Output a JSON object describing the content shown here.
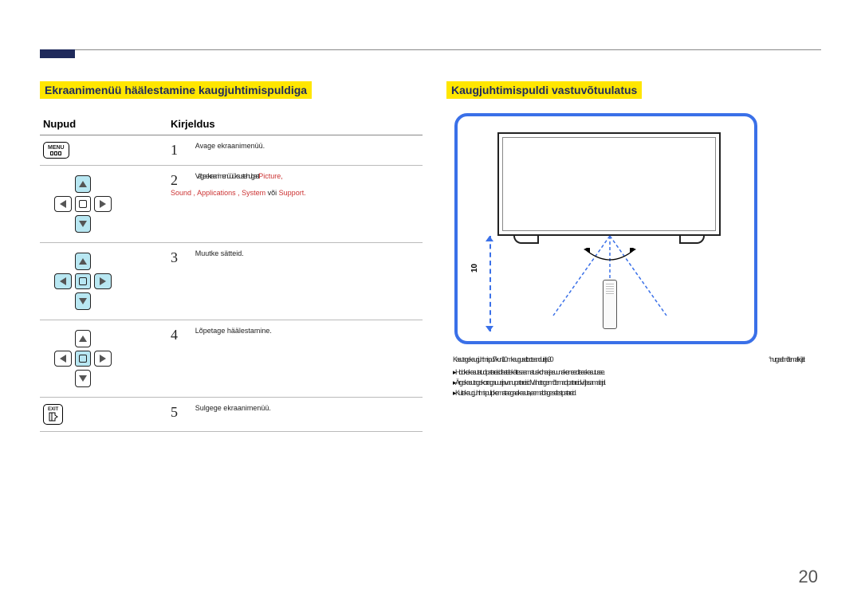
{
  "page_number": "20",
  "left": {
    "heading": "Ekraanimenüü häälestamine kaugjuhtimispuldiga",
    "th_buttons": "Nupud",
    "th_desc": "Kirjeldus",
    "menu_label": "MENU",
    "exit_label": "EXIT",
    "steps": {
      "s1": {
        "no": "1",
        "tiny": "Avage ekraanimenüü."
      },
      "s2": {
        "no": "2",
        "tiny": "Valige ekraanimenüü üksuste hulgast ",
        "red1": "Picture",
        "sep": ", ",
        "red2": "Sound",
        "red3": "Applications",
        "red4": "System",
        "or_word": " või ",
        "red5": "Support",
        "period": "."
      },
      "s3": {
        "no": "3",
        "tiny": "Muutke sätteid."
      },
      "s4": {
        "no": "4",
        "tiny": "Lõpetage häälestamine."
      },
      "s5": {
        "no": "5",
        "tiny": "Sulgege ekraanimenüü."
      }
    }
  },
  "right": {
    "heading": "Kaugjuhtimispuldi vastuvõtuulatus",
    "distance_label": "10",
    "note_main_left": "Kasutage kaugjuhtimispulti 7 kuni 10 m kauguselt toote andurist ja 30",
    "note_main_right_deg": "° nurga all mõlemalt küljelt.",
    "bullets": [
      "Hoidke kasutatud patareisid lastele kättesaamatus kohas ja suunake need taaskasutusse.",
      "Ärge kasutage korraga uusi ja vanu patareisid. Vahetage mõlemad patareid välja samal ajal.",
      "Kui te kaugjuhtimispulti pikemat aega ei kasuta, eemaldage sellest patareid."
    ]
  }
}
